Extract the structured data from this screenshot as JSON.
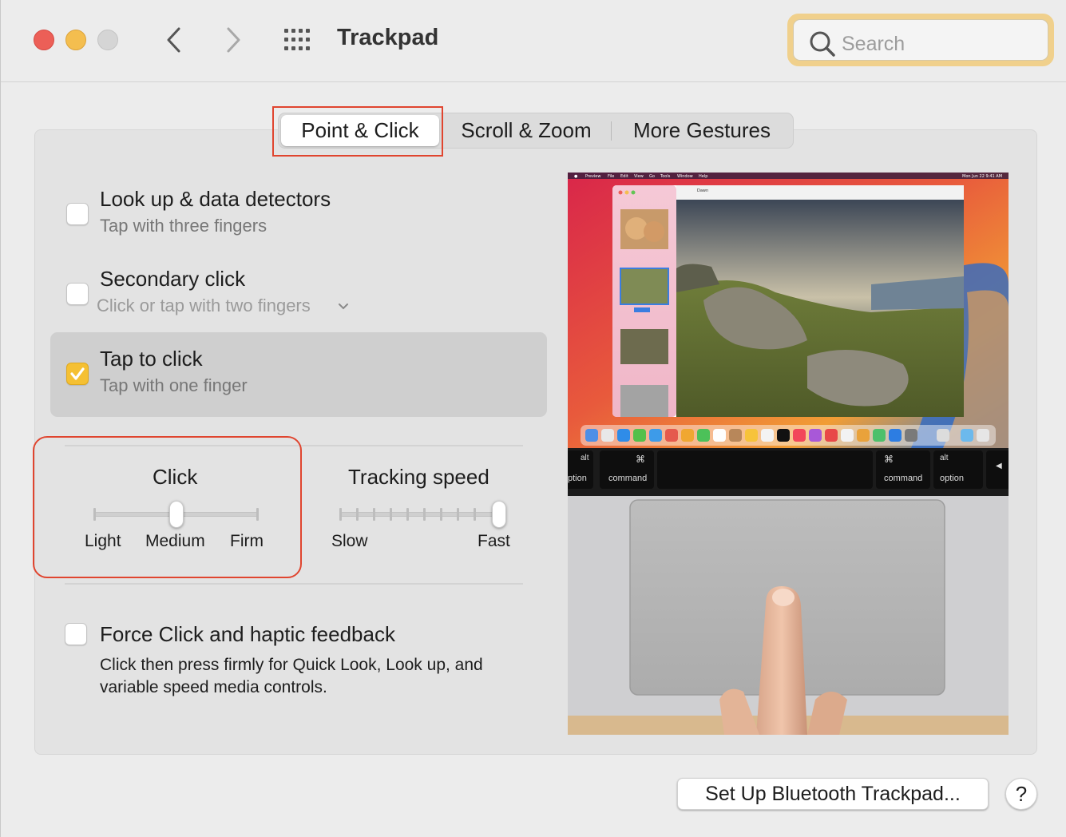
{
  "window": {
    "title": "Trackpad"
  },
  "search": {
    "placeholder": "Search"
  },
  "tabs": [
    {
      "label": "Point & Click",
      "active": true
    },
    {
      "label": "Scroll & Zoom",
      "active": false
    },
    {
      "label": "More Gestures",
      "active": false
    }
  ],
  "options": {
    "lookup": {
      "title": "Look up & data detectors",
      "subtitle": "Tap with three fingers",
      "checked": false
    },
    "secondary": {
      "title": "Secondary click",
      "subtitle": "Click or tap with two fingers",
      "checked": false
    },
    "tap": {
      "title": "Tap to click",
      "subtitle": "Tap with one finger",
      "checked": true
    },
    "force": {
      "title": "Force Click and haptic feedback",
      "description": "Click then press firmly for Quick Look, Look up, and variable speed media controls.",
      "checked": false
    }
  },
  "click_slider": {
    "title": "Click",
    "labels": [
      "Light",
      "Medium",
      "Firm"
    ],
    "value": "Medium"
  },
  "tracking_slider": {
    "title": "Tracking speed",
    "min_label": "Slow",
    "max_label": "Fast",
    "level": 1.0
  },
  "preview": {
    "keys": {
      "alt_left": "alt",
      "option_left": "ption",
      "cmd_symbol": "⌘",
      "command": "command",
      "alt_right": "alt",
      "option_right": "option"
    }
  },
  "buttons": {
    "setup_bluetooth": "Set Up Bluetooth Trackpad...",
    "help": "?"
  },
  "colors": {
    "accent": "#f5c033",
    "annotation": "#e0452f"
  }
}
